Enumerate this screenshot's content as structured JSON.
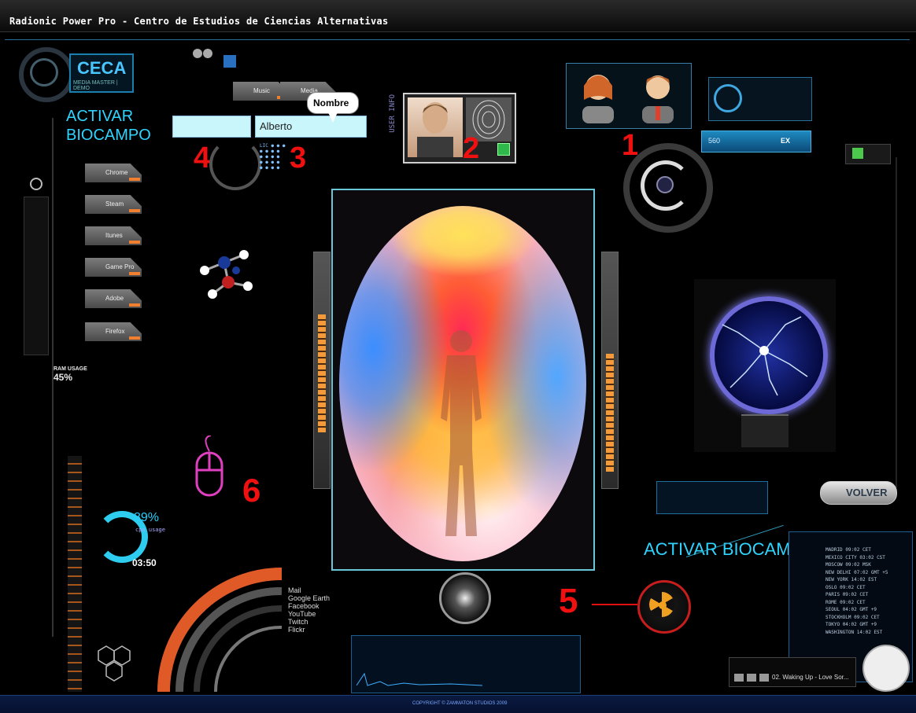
{
  "window": {
    "title": "Radionic Power Pro - Centro de Estudios de Ciencias Alternativas"
  },
  "logo": {
    "title": "CECA",
    "subtitle": "MEDIA MASTER | DEMO"
  },
  "activar_top": {
    "line1": "ACTIVAR",
    "line2": "BIOCAMPO"
  },
  "activar_bottom": "ACTIVAR BIOCAMPO",
  "menu_items": [
    "Chrome",
    "Steam",
    "Itunes",
    "Game Pro",
    "Adobe",
    "Firefox"
  ],
  "top_tabs": [
    "Music",
    "Media"
  ],
  "name_field": {
    "value": "Alberto",
    "tooltip": "Nombre"
  },
  "markers": {
    "m1": "1",
    "m2": "2",
    "m3": "3",
    "m4": "4",
    "m5": "5",
    "m6": "6"
  },
  "volver": "VOLVER",
  "ram": {
    "label": "RAM USAGE",
    "value": "45%"
  },
  "cpu": {
    "percent": "89%",
    "label": "cpu usage"
  },
  "clock": "03:50",
  "usage_value": "560",
  "usage_unit": "EX",
  "copyright": "COPYRIGHT © ZAMMATON STUDIOS 2009",
  "music_track": "02. Waking Up - Love Sor...",
  "user_info": {
    "label": "USER INFO"
  },
  "social_labels": [
    "Mail",
    "Google Earth",
    "Facebook",
    "YouTube",
    "Twitch",
    "Flickr"
  ],
  "world_clock": [
    {
      "city": "MADRID",
      "time": "09:02",
      "zone": "CET"
    },
    {
      "city": "MEXICO CITY",
      "time": "03:02",
      "zone": "CST"
    },
    {
      "city": "MOSCOW",
      "time": "09:02",
      "zone": "MSK"
    },
    {
      "city": "NEW DELHI",
      "time": "07:02",
      "zone": "GMT +5"
    },
    {
      "city": "NEW YORK",
      "time": "14:02",
      "zone": "EST"
    },
    {
      "city": "OSLO",
      "time": "09:02",
      "zone": "CET"
    },
    {
      "city": "PARIS",
      "time": "09:02",
      "zone": "CET"
    },
    {
      "city": "ROME",
      "time": "09:02",
      "zone": "CET"
    },
    {
      "city": "SEOUL",
      "time": "04:02",
      "zone": "GMT +9"
    },
    {
      "city": "STOCKHOLM",
      "time": "09:02",
      "zone": "CET"
    },
    {
      "city": "TOKYO",
      "time": "04:02",
      "zone": "GMT +9"
    },
    {
      "city": "WASHINGTON",
      "time": "14:02",
      "zone": "EST"
    }
  ],
  "colors": {
    "accent": "#2fd4ff",
    "marker": "#f01010",
    "frame": "#69c8d8",
    "orange": "#f08030"
  }
}
